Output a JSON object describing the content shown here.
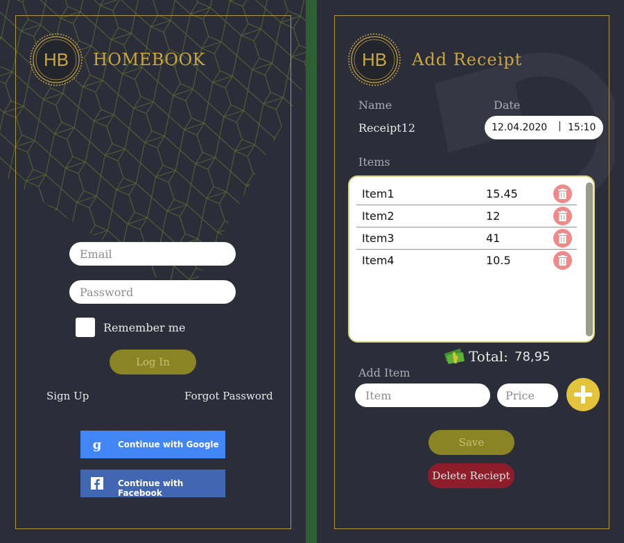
{
  "login": {
    "brand": "HOMEBOOK",
    "logo_text": "HB",
    "email_placeholder": "Email",
    "password_placeholder": "Password",
    "remember_label": "Remember me",
    "login_label": "Log In",
    "signup_label": "Sign Up",
    "forgot_label": "Forgot Password",
    "google_label": "Continue with Google",
    "facebook_label": "Continue with Facebook"
  },
  "receipt": {
    "title": "Add Receipt",
    "logo_text": "HB",
    "name_label": "Name",
    "date_label": "Date",
    "name_value": "Receipt12",
    "date_value": "12.04.2020",
    "time_value": "15:10",
    "items_label": "Items",
    "items": [
      {
        "name": "Item1",
        "price": "15.45"
      },
      {
        "name": "Item2",
        "price": "12"
      },
      {
        "name": "Item3",
        "price": "41"
      },
      {
        "name": "Item4",
        "price": "10.5"
      }
    ],
    "total_label": "Total:",
    "total_value": "78,95",
    "add_item_label": "Add Item",
    "item_placeholder": "Item",
    "price_placeholder": "Price",
    "save_label": "Save",
    "delete_label": "Delete Reciept"
  },
  "colors": {
    "background": "#2b2e38",
    "gold": "#c9a640",
    "save_button": "#8a8424",
    "delete_button": "#8e1d2c",
    "google": "#4285f4",
    "facebook": "#4267b2",
    "delete_icon": "#ef8a8a",
    "add_button": "#e3c33c"
  },
  "icons": [
    "hb-logo",
    "google-icon",
    "facebook-icon",
    "trash-icon",
    "money-icon",
    "plus-icon"
  ]
}
